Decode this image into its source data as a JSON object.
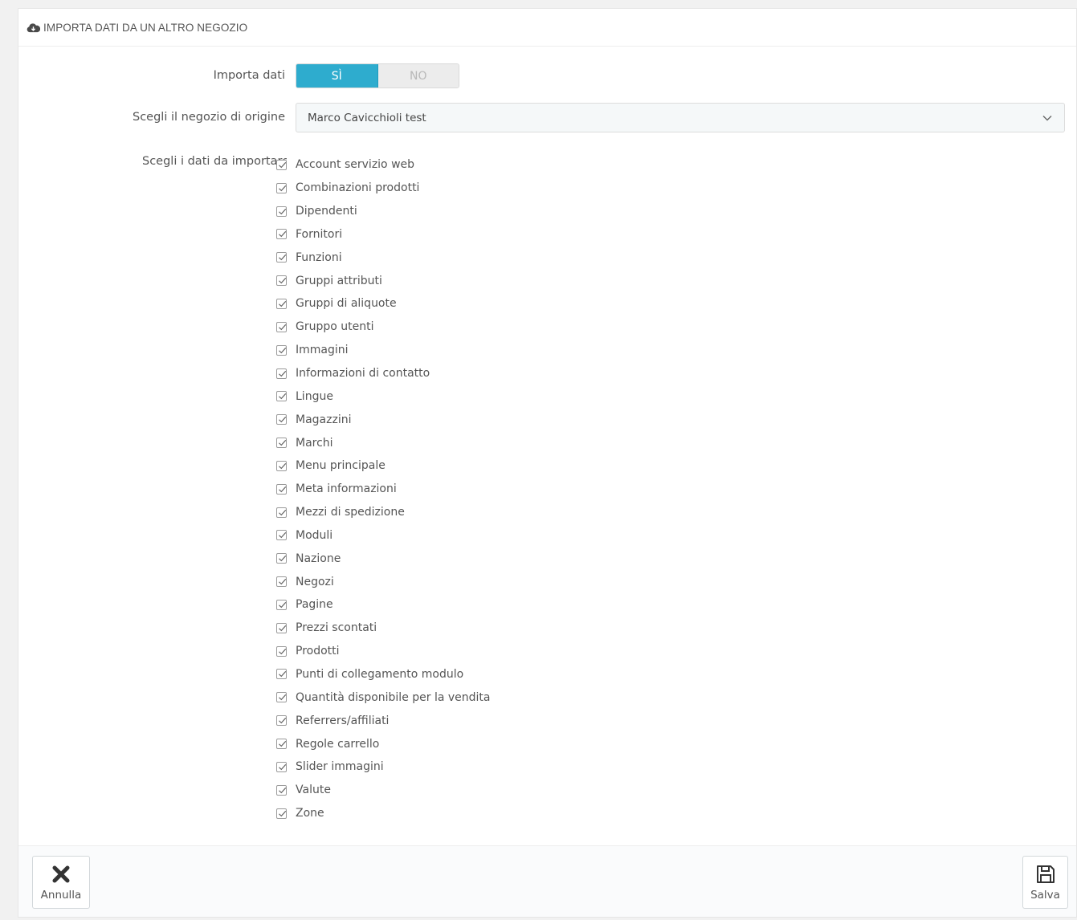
{
  "panel": {
    "title": "IMPORTA DATI DA UN ALTRO NEGOZIO",
    "title_icon": "cloud-download-icon"
  },
  "form": {
    "import_label": "Importa dati",
    "toggle": {
      "yes": "SÌ",
      "no": "NO",
      "selected": "yes",
      "accent_color": "#2eacce"
    },
    "source_label": "Scegli il negozio di origine",
    "source_value": "Marco Cavicchioli test",
    "data_label": "Scegli i dati da importare",
    "items": [
      {
        "label": "Account servizio web",
        "checked": true
      },
      {
        "label": "Combinazioni prodotti",
        "checked": true
      },
      {
        "label": "Dipendenti",
        "checked": true
      },
      {
        "label": "Fornitori",
        "checked": true
      },
      {
        "label": "Funzioni",
        "checked": true
      },
      {
        "label": "Gruppi attributi",
        "checked": true
      },
      {
        "label": "Gruppi di aliquote",
        "checked": true
      },
      {
        "label": "Gruppo utenti",
        "checked": true
      },
      {
        "label": "Immagini",
        "checked": true
      },
      {
        "label": "Informazioni di contatto",
        "checked": true
      },
      {
        "label": "Lingue",
        "checked": true
      },
      {
        "label": "Magazzini",
        "checked": true
      },
      {
        "label": "Marchi",
        "checked": true
      },
      {
        "label": "Menu principale",
        "checked": true
      },
      {
        "label": "Meta informazioni",
        "checked": true
      },
      {
        "label": "Mezzi di spedizione",
        "checked": true
      },
      {
        "label": "Moduli",
        "checked": true
      },
      {
        "label": "Nazione",
        "checked": true
      },
      {
        "label": "Negozi",
        "checked": true
      },
      {
        "label": "Pagine",
        "checked": true
      },
      {
        "label": "Prezzi scontati",
        "checked": true
      },
      {
        "label": "Prodotti",
        "checked": true
      },
      {
        "label": "Punti di collegamento modulo",
        "checked": true
      },
      {
        "label": "Quantità disponibile per la vendita",
        "checked": true
      },
      {
        "label": "Referrers/affiliati",
        "checked": true
      },
      {
        "label": "Regole carrello",
        "checked": true
      },
      {
        "label": "Slider immagini",
        "checked": true
      },
      {
        "label": "Valute",
        "checked": true
      },
      {
        "label": "Zone",
        "checked": true
      }
    ]
  },
  "footer": {
    "cancel_label": "Annulla",
    "cancel_icon": "close-icon",
    "save_label": "Salva",
    "save_icon": "floppy-disk-icon"
  }
}
